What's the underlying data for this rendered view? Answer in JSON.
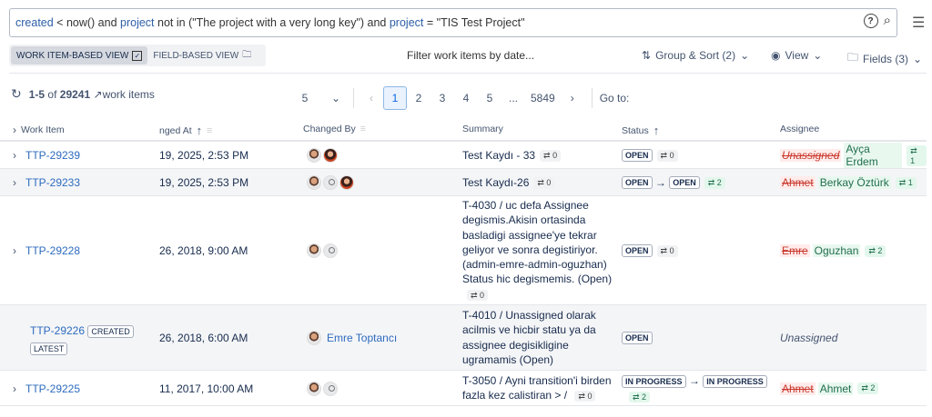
{
  "query": {
    "parts": [
      [
        "kw",
        "created"
      ],
      [
        "t",
        " < now() and "
      ],
      [
        "kw",
        "project"
      ],
      [
        "t",
        " not in (\"The project with a very long key\") and "
      ],
      [
        "kw",
        "project"
      ],
      [
        "t",
        " = \"TIS Test Project\""
      ]
    ]
  },
  "query_tokens": {
    "t0": "created",
    "t1": " < now() and ",
    "t2": "project",
    "t3": " not in (\"The project with a very long key\") and ",
    "t4": "project",
    "t5": " = \"TIS Test Project\""
  },
  "view_toggle": {
    "item_view": "WORK ITEM-BASED VIEW",
    "field_view": "FIELD-BASED VIEW"
  },
  "filter_label": "Filter work items by date...",
  "toolbar": {
    "group_sort": "Group & Sort (2)",
    "view": "View",
    "fields": "Fields (3)"
  },
  "results": {
    "range": "1-5",
    "of": "of",
    "total": "29241",
    "suffix": "work items"
  },
  "pager": {
    "page_size": "5",
    "pages": [
      "1",
      "2",
      "3",
      "4",
      "5",
      "...",
      "5849"
    ],
    "goto": "Go to:"
  },
  "columns": {
    "work_item": "Work Item",
    "changed_at": "nged At",
    "changed_by": "Changed By",
    "summary": "Summary",
    "status": "Status",
    "assignee": "Assignee"
  },
  "rows": [
    {
      "key": "TTP-29239",
      "changed_at": "19, 2025, 2:53 PM",
      "summary": "Test Kaydı - 33",
      "summary_count": "0",
      "status_from": "OPEN",
      "status_count": "0",
      "assignee_old": "Unassigned",
      "assignee_new": "Ayça Erdem",
      "assignee_count": "1"
    },
    {
      "key": "TTP-29233",
      "changed_at": "19, 2025, 2:53 PM",
      "summary": "Test Kaydı-26",
      "summary_count": "0",
      "status_from": "OPEN",
      "status_to": "OPEN",
      "status_count": "2",
      "assignee_old": "Ahmet",
      "assignee_new": "Berkay Öztürk",
      "assignee_count": "1"
    },
    {
      "key": "TTP-29228",
      "changed_at": "26, 2018, 9:00 AM",
      "summary": "T-4030 / uc defa Assignee degismis.Akisin ortasinda basladigi assignee'ye tekrar geliyor ve sonra degistiriyor. (admin-emre-admin-oguzhan) Status hic degismemis. (Open)",
      "summary_count": "0",
      "status_from": "OPEN",
      "status_count": "0",
      "assignee_old": "Emre",
      "assignee_new": "Oguzhan",
      "assignee_count": "2"
    },
    {
      "key": "TTP-29226",
      "badge1": "CREATED",
      "badge2": "LATEST",
      "changed_at": "26, 2018, 6:00 AM",
      "changed_by": "Emre Toptancı",
      "summary": "T-4010 / Unassigned olarak acilmis ve hicbir statu ya da assignee degisikligine ugramamis (Open)",
      "status_from": "OPEN",
      "assignee": "Unassigned"
    },
    {
      "key": "TTP-29225",
      "changed_at": "11, 2017, 10:00 AM",
      "summary": "T-3050 / Ayni transition'i birden fazla kez calistiran > /",
      "summary_count": "0",
      "status_from": "IN PROGRESS",
      "status_to": "IN PROGRESS",
      "status_count": "2",
      "assignee_old": "Ahmet",
      "assignee_new": "Ahmet",
      "assignee_count": "2"
    }
  ],
  "arrow": "→",
  "icons": {
    "help": "?",
    "search": "⌕",
    "menu": "☰",
    "swap": "⇄"
  }
}
